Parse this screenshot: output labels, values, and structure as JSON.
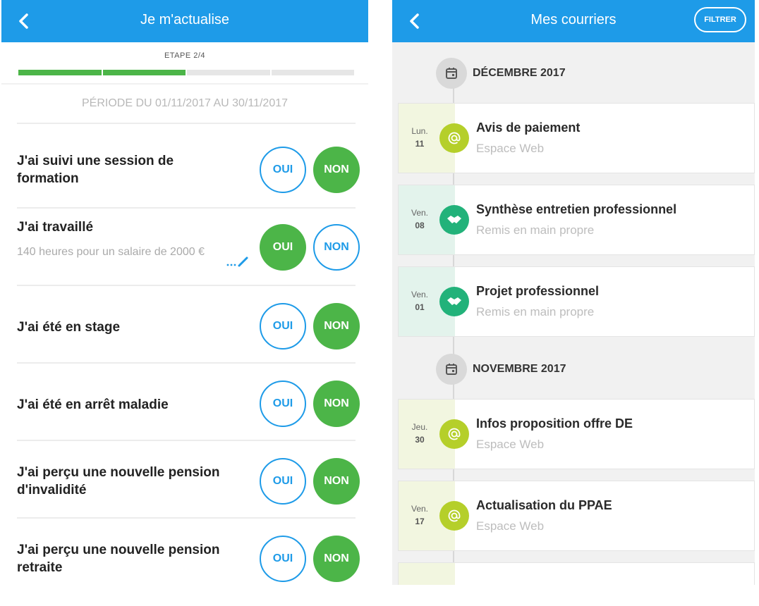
{
  "left_screen": {
    "header": {
      "title": "Je m'actualise"
    },
    "step_label": "ETAPE 2/4",
    "progress": {
      "completed_segments": 2,
      "total_segments": 4
    },
    "period": "PÉRIODE DU 01/11/2017 AU 30/11/2017",
    "questions": [
      {
        "text": "J'ai suivi une session de formation",
        "detail": "",
        "yes_label": "OUI",
        "no_label": "NON",
        "answer": "NON"
      },
      {
        "text": "J'ai travaillé",
        "detail": "140 heures pour un salaire de 2000 €",
        "yes_label": "OUI",
        "no_label": "NON",
        "answer": "OUI"
      },
      {
        "text": "J'ai été en stage",
        "detail": "",
        "yes_label": "OUI",
        "no_label": "NON",
        "answer": "NON"
      },
      {
        "text": "J'ai été en arrêt maladie",
        "detail": "",
        "yes_label": "OUI",
        "no_label": "NON",
        "answer": "NON"
      },
      {
        "text": "J'ai perçu une nouvelle pension d'invalidité",
        "detail": "",
        "yes_label": "OUI",
        "no_label": "NON",
        "answer": "NON"
      },
      {
        "text": "J'ai perçu une nouvelle pension retraite",
        "detail": "",
        "yes_label": "OUI",
        "no_label": "NON",
        "answer": "NON"
      }
    ]
  },
  "right_screen": {
    "header": {
      "title": "Mes courriers",
      "filter_label": "FILTRER"
    },
    "months": [
      {
        "label": "DÉCEMBRE 2017"
      },
      {
        "label": "NOVEMBRE 2017"
      }
    ],
    "letters": [
      {
        "day": "Lun.",
        "date": "11",
        "title": "Avis de paiement",
        "channel": "Espace Web",
        "icon": "at-sign-icon"
      },
      {
        "day": "Ven.",
        "date": "08",
        "title": "Synthèse entretien professionnel",
        "channel": "Remis en main propre",
        "icon": "handshake-icon"
      },
      {
        "day": "Ven.",
        "date": "01",
        "title": "Projet professionnel",
        "channel": "Remis en main propre",
        "icon": "handshake-icon"
      },
      {
        "day": "Jeu.",
        "date": "30",
        "title": "Infos proposition offre DE",
        "channel": "Espace Web",
        "icon": "at-sign-icon"
      },
      {
        "day": "Ven.",
        "date": "17",
        "title": "Actualisation du PPAE",
        "channel": "Espace Web",
        "icon": "at-sign-icon"
      }
    ]
  },
  "colors": {
    "header_blue": "#1e9be8",
    "answer_green": "#4cb548",
    "web_dot": "#b5cf2a",
    "hand_dot": "#22b27a"
  }
}
